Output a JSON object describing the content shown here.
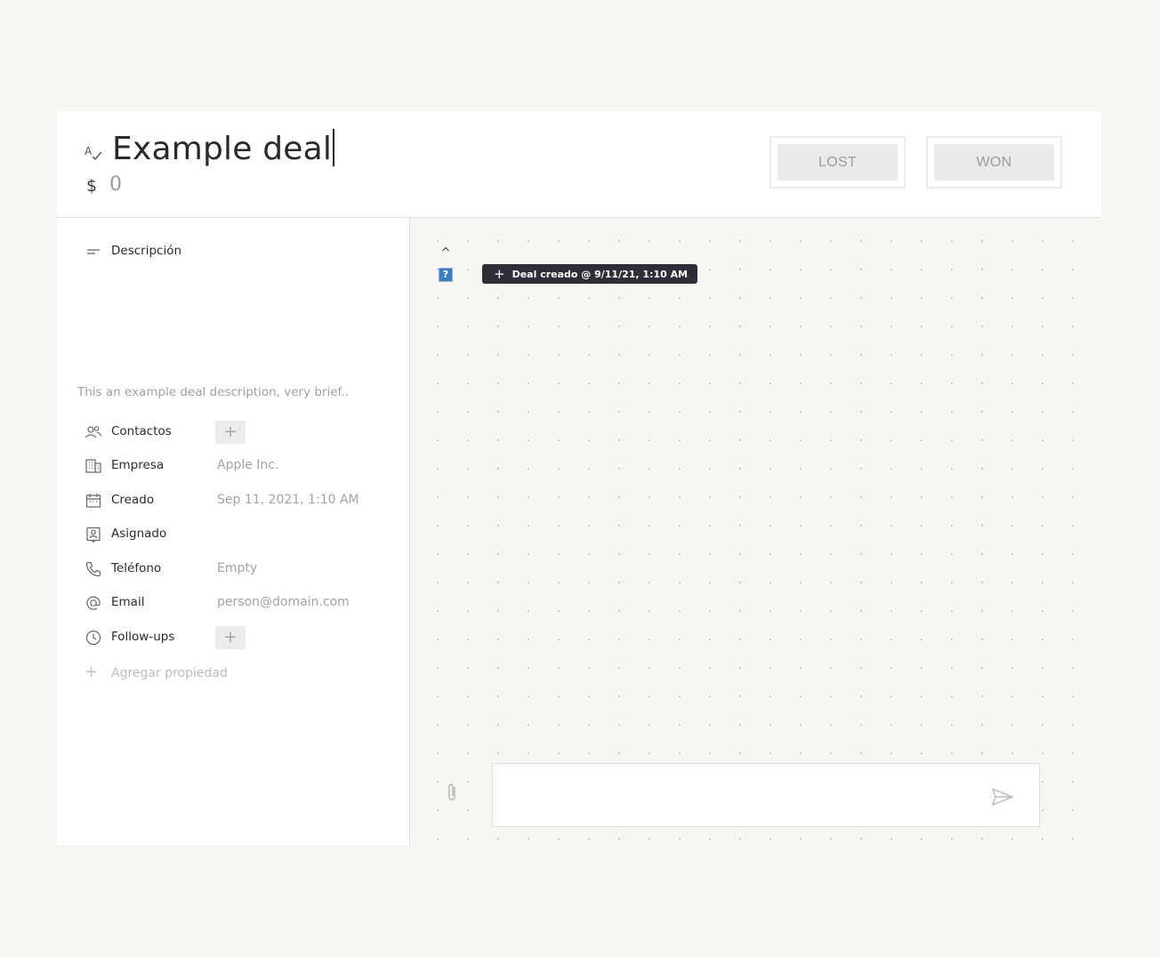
{
  "deal": {
    "title": "Example deal",
    "currency_symbol": "$",
    "amount": "0"
  },
  "status_buttons": {
    "lost_label": "LOST",
    "won_label": "WON"
  },
  "properties": {
    "description": {
      "label": "Descripción",
      "value": "This an example deal description, very brief.."
    },
    "contacts": {
      "label": "Contactos",
      "add": "+"
    },
    "company": {
      "label": "Empresa",
      "value": "Apple Inc."
    },
    "created": {
      "label": "Creado",
      "value": "Sep 11, 2021, 1:10 AM"
    },
    "assigned": {
      "label": "Asignado",
      "value": ""
    },
    "phone": {
      "label": "Teléfono",
      "value": "Empty"
    },
    "email": {
      "label": "Email",
      "value": "person@domain.com"
    },
    "followups": {
      "label": "Follow-ups",
      "add": "+"
    },
    "add_property": {
      "plus": "+",
      "label": "Agregar propiedad"
    }
  },
  "feed": {
    "avatar_glyph": "?",
    "events": [
      {
        "plus": "+",
        "text": "Deal creado @ 9/11/21, 1:10 AM"
      }
    ]
  },
  "composer": {
    "value": "",
    "placeholder": ""
  },
  "icons": {
    "title": "spellcheck-icon",
    "description": "short-text-icon",
    "contacts": "people-icon",
    "company": "building-icon",
    "created": "calendar-icon",
    "assigned": "assignee-badge-icon",
    "phone": "phone-icon",
    "email": "at-sign-icon",
    "followups": "clock-icon",
    "attach": "paperclip-icon",
    "send": "send-icon",
    "collapse": "chevron-up-icon"
  },
  "colors": {
    "background": "#f7f6f2",
    "card": "#ffffff",
    "pill": "#2e2e38",
    "status_button": "#eaeaea",
    "muted_text": "#a3a3a3",
    "avatar": "#3d7bc4"
  }
}
